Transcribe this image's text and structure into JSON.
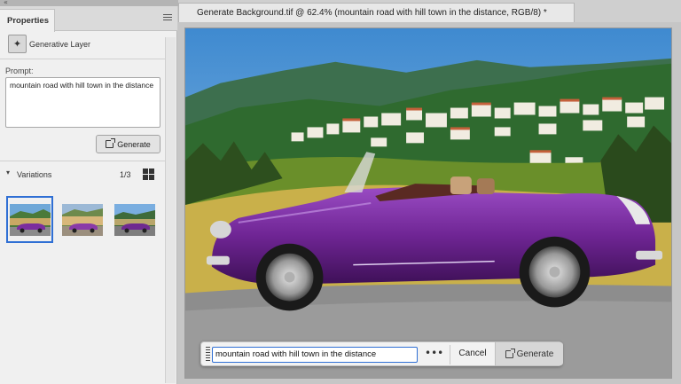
{
  "panel": {
    "tab_label": "Properties",
    "layer_label": "Generative Layer",
    "prompt_label": "Prompt:",
    "prompt_text": "mountain road with hill town in the distance",
    "generate_label": "Generate",
    "variations_label": "Variations",
    "variations_count": "1/3",
    "selected_variation": 1,
    "variations_total": 3
  },
  "document": {
    "tab_title": "Generate Background.tif @ 62.4% (mountain road with hill town in the distance, RGB/8) *",
    "image_subject": "purple convertible on mountain road with hill town"
  },
  "taskbar": {
    "prompt_value": "mountain road with hill town in the distance",
    "more_label": "•••",
    "cancel_label": "Cancel",
    "generate_label": "Generate"
  },
  "icons": {
    "collapse": "double-chevron-left-icon",
    "panel_menu": "hamburger-menu-icon",
    "layer": "generative-layer-icon",
    "generate": "generate-icon",
    "variations_caret": "chevron-down-icon",
    "grid_view": "grid-view-icon",
    "grip": "drag-handle-icon"
  },
  "colors": {
    "accent": "#2f6fd4",
    "car": "#7b2e9e",
    "sky": "#5a9fd6"
  }
}
